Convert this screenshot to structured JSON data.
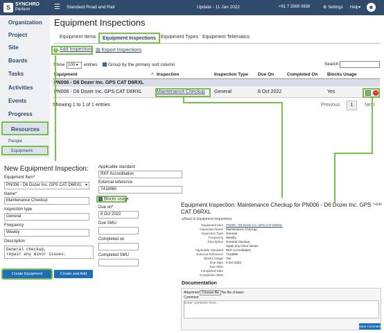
{
  "app": {
    "logo_text": "SYNCHRO",
    "logo_sub": "Perform",
    "project": "Standard Road and Rail",
    "update": "Update - 11 Jan 2022",
    "phone": "+61 7 3369 0838",
    "settings": "Settings",
    "help": "Help"
  },
  "sidebar": {
    "items": [
      "Organization",
      "Project",
      "Site",
      "Boards",
      "Tasks",
      "Activities",
      "Events",
      "Progress",
      "Resources"
    ],
    "subitems": [
      "People",
      "Equipment"
    ]
  },
  "main": {
    "title": "Equipment Inspections",
    "tabs": [
      "Equipment Items",
      "Equipment Inspections",
      "Equipment Types",
      "Equipment Telematics"
    ],
    "add": "Add Inspection",
    "export": "Export Inspections",
    "show": "Show",
    "show_value": "100",
    "entries": "entries",
    "group_label": "Group by the primary sort column",
    "search_label": "Search:",
    "columns": [
      "Equipment",
      "Inspection",
      "Inspection Type",
      "Due On",
      "Completed On",
      "Blocks Usage"
    ],
    "group": "PN006 - D6 Dozer Inc. GPS CAT D6RXL",
    "row": {
      "equipment": "PN006 - D6 Dozer Inc. GPS CAT D6RXL",
      "inspection": "Maintenance Checkup",
      "type": "General",
      "due": "8 Oct 2022",
      "completed": "",
      "blocks": "Yes"
    },
    "showing": "Showing 1 to 1 of 1 entries",
    "previous": "Previous",
    "page": "1",
    "next": "Next"
  },
  "form": {
    "title": "New Equipment Inspection:",
    "equipment_label": "Equipment Item*",
    "equipment_value": "PN006 - D6 Dozer Inc. GPS CAT D6RXL",
    "name_label": "Name*",
    "name_value": "Maintenance Checkup",
    "type_label": "Inspection type",
    "type_value": "General",
    "frequency_label": "Frequency",
    "frequency_value": "Weekly",
    "description_label": "Description",
    "description_value": "General checkup,\nrepair any minor issues.",
    "standard_label": "Applicable standard",
    "standard_value": "RKF Accreditation",
    "external_label": "External reference",
    "external_value": "7418880",
    "blocks_label": "Blocks usage",
    "due_label": "Due on*",
    "due_value": "8 Oct 2022",
    "due_smu_label": "Due SMU",
    "completed_label": "Completed on",
    "completed_smu_label": "Completed SMU",
    "create_btn": "Create Equipment Inspection",
    "create_another_btn": "Create and Add Another"
  },
  "detail": {
    "title": "Equipment Inspection: Maintenance Checkup for PN006 - D6 Dozer Inc. GPS CAT D6RXL",
    "edit": "Edit",
    "back": "Back to Equipment Inspections",
    "rows": [
      {
        "label": "Equipment Item",
        "value": "PN006 - D6 Dozer Inc. GPS CAT D6RXL"
      },
      {
        "label": "Inspection Name",
        "value": "Maintenance Checkup"
      },
      {
        "label": "Inspection Type",
        "value": "General"
      },
      {
        "label": "Frequency",
        "value": "Weekly"
      },
      {
        "label": "Description",
        "value": "General checkup,"
      },
      {
        "label": "",
        "value": "repair any minor issues."
      },
      {
        "label": "Applicable Standard",
        "value": "RKF Accreditation"
      },
      {
        "label": "External Reference",
        "value": "7418880"
      },
      {
        "label": "Blocks Usage",
        "value": "Yes"
      },
      {
        "label": "Due Date",
        "value": "8 Oct 2022"
      },
      {
        "label": "Due SMU",
        "value": ""
      },
      {
        "label": "Completed Date",
        "value": ""
      },
      {
        "label": "Completion SMU",
        "value": ""
      }
    ],
    "doc_title": "Documentation",
    "attachment_label": "Attachment",
    "choose_file": "Choose file",
    "no_file": "No file chosen",
    "comment_label": "Comment",
    "comment_placeholder": "Enter comment here...",
    "save_comment": "Save Comment"
  }
}
